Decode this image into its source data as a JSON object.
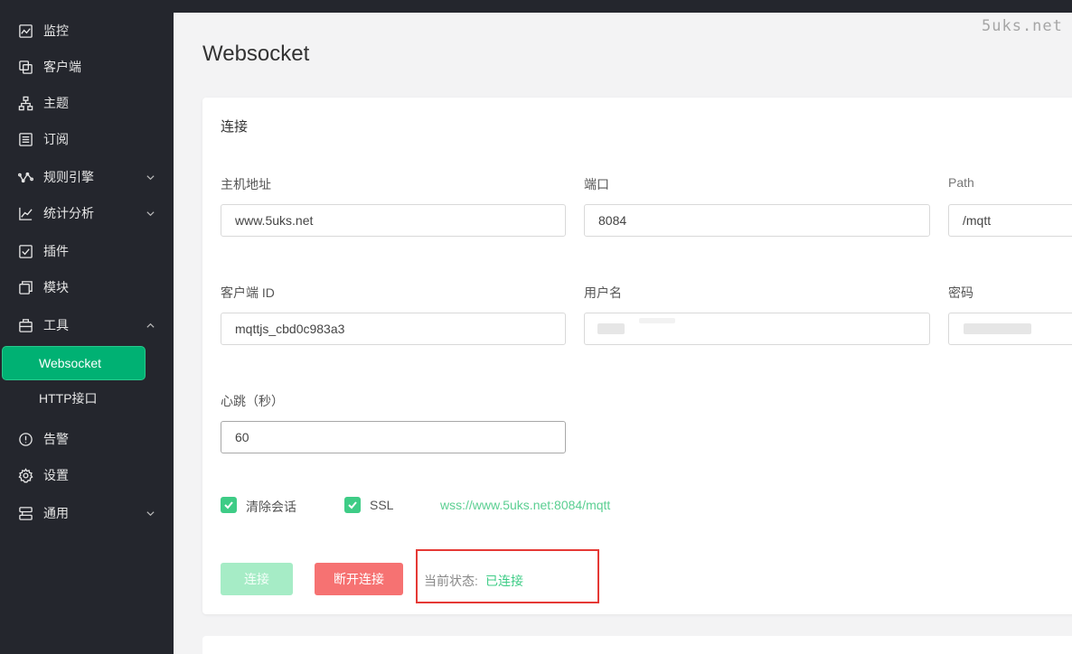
{
  "watermark": "5uks.net",
  "sidebar": {
    "items": [
      {
        "label": "监控",
        "icon": "chart-icon"
      },
      {
        "label": "客户端",
        "icon": "copy-icon"
      },
      {
        "label": "主题",
        "icon": "hierarchy-icon"
      },
      {
        "label": "订阅",
        "icon": "list-icon"
      },
      {
        "label": "规则引擎",
        "icon": "rule-icon"
      },
      {
        "label": "统计分析",
        "icon": "trend-icon"
      },
      {
        "label": "插件",
        "icon": "checkbox-icon"
      },
      {
        "label": "模块",
        "icon": "module-icon"
      },
      {
        "label": "工具",
        "icon": "toolbox-icon"
      },
      {
        "label": "告警",
        "icon": "alert-icon"
      },
      {
        "label": "设置",
        "icon": "gear-icon"
      },
      {
        "label": "通用",
        "icon": "server-icon"
      }
    ],
    "sub_items": [
      {
        "label": "Websocket",
        "active": true
      },
      {
        "label": "HTTP接口",
        "active": false
      }
    ]
  },
  "page": {
    "title": "Websocket"
  },
  "connection": {
    "title": "连接",
    "host": {
      "label": "主机地址",
      "value": "www.5uks.net"
    },
    "port": {
      "label": "端口",
      "value": "8084"
    },
    "path": {
      "label": "Path",
      "value": "/mqtt"
    },
    "client_id": {
      "label": "客户端 ID",
      "value": "mqttjs_cbd0c983a3"
    },
    "username": {
      "label": "用户名",
      "value": ""
    },
    "password": {
      "label": "密码",
      "value": ""
    },
    "keepalive": {
      "label": "心跳（秒）",
      "value": "60"
    },
    "clean_session": {
      "label": "清除会话",
      "checked": true
    },
    "ssl": {
      "label": "SSL",
      "checked": true
    },
    "url": "wss://www.5uks.net:8084/mqtt",
    "connect_label": "连接",
    "disconnect_label": "断开连接",
    "status_label": "当前状态:",
    "status_value": "已连接"
  },
  "colors": {
    "accent": "#00b173",
    "sidebar_bg": "#24262d",
    "status_ok": "#3ecc86",
    "danger": "#f67272",
    "highlight_box": "#e53935"
  }
}
